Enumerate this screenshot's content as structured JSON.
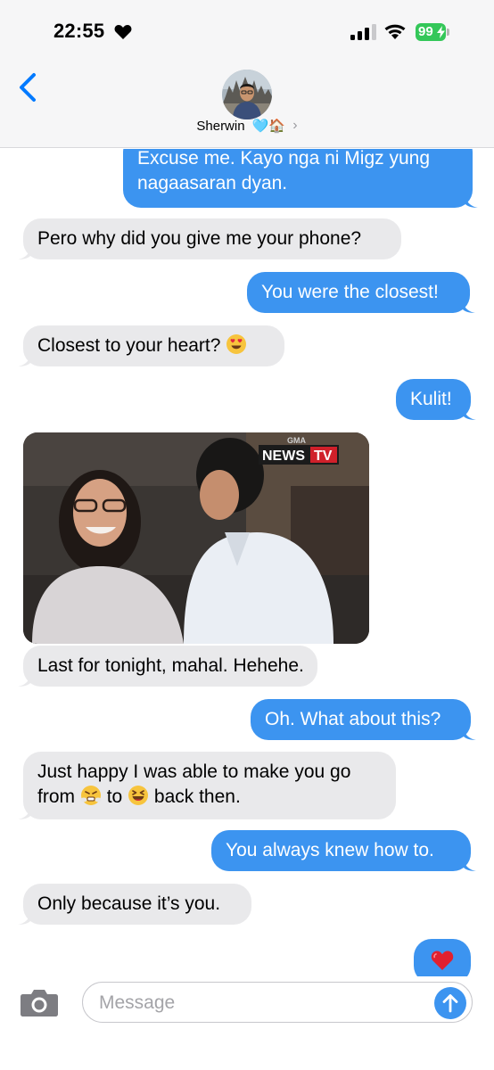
{
  "status_bar": {
    "time": "22:55",
    "battery_percent": "99",
    "icons": [
      "heart-icon",
      "cellular-signal-icon",
      "wifi-icon",
      "battery-charging-icon"
    ]
  },
  "header": {
    "contact_name": "Sherwin",
    "contact_emoji": "🩵🏠",
    "chevron": "›",
    "icons": [
      "back-chevron-icon",
      "contact-avatar"
    ]
  },
  "messages": [
    {
      "from": "me",
      "text": "Excuse me. Kayo nga ni Migz yung",
      "text2": "nagaasaran dyan."
    },
    {
      "from": "them",
      "text": "Pero why did you give me your phone?"
    },
    {
      "from": "me",
      "text": "You were the closest!"
    },
    {
      "from": "them",
      "text": "Closest to your heart?",
      "emoji": "😍"
    },
    {
      "from": "me",
      "text": "Kulit!"
    },
    {
      "from": "them",
      "type": "image",
      "overlay_logo": "GMA",
      "overlay_text": "NEWS",
      "overlay_badge": "TV"
    },
    {
      "from": "them",
      "text": "Last for tonight, mahal. Hehehe."
    },
    {
      "from": "me",
      "text": "Oh. What about this?"
    },
    {
      "from": "them",
      "text": "Just happy I was able to make you go",
      "text2a": "from",
      "text2b": "to",
      "text2c": "back then.",
      "emoji_a": "😤",
      "emoji_b": "😆"
    },
    {
      "from": "me",
      "text": "You always knew how to."
    },
    {
      "from": "them",
      "text": "Only because it’s you."
    },
    {
      "from": "me",
      "text": "❤️"
    }
  ],
  "composer": {
    "placeholder": "Message",
    "icons": [
      "camera-icon",
      "send-arrow-icon"
    ]
  },
  "colors": {
    "sent_bubble": "#3c94f0",
    "received_bubble": "#e9e9eb",
    "accent": "#007aff",
    "battery": "#34c759"
  }
}
